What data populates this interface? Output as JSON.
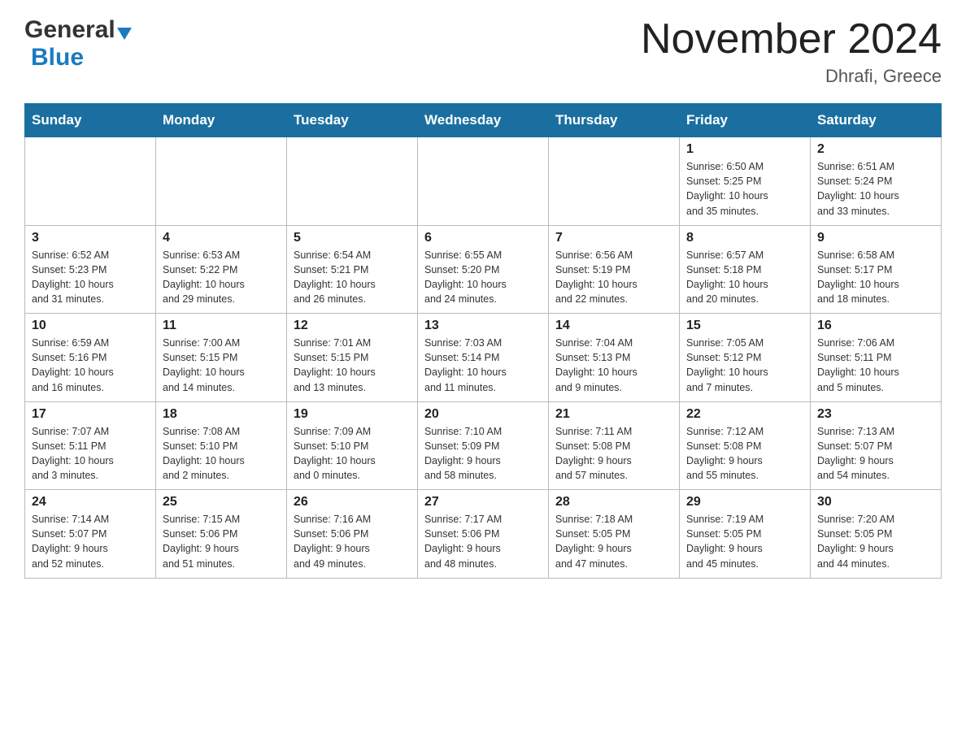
{
  "header": {
    "logo_general": "General",
    "logo_blue": "Blue",
    "month_year": "November 2024",
    "location": "Dhrafi, Greece"
  },
  "weekdays": [
    "Sunday",
    "Monday",
    "Tuesday",
    "Wednesday",
    "Thursday",
    "Friday",
    "Saturday"
  ],
  "rows": [
    [
      {
        "day": "",
        "info": ""
      },
      {
        "day": "",
        "info": ""
      },
      {
        "day": "",
        "info": ""
      },
      {
        "day": "",
        "info": ""
      },
      {
        "day": "",
        "info": ""
      },
      {
        "day": "1",
        "info": "Sunrise: 6:50 AM\nSunset: 5:25 PM\nDaylight: 10 hours\nand 35 minutes."
      },
      {
        "day": "2",
        "info": "Sunrise: 6:51 AM\nSunset: 5:24 PM\nDaylight: 10 hours\nand 33 minutes."
      }
    ],
    [
      {
        "day": "3",
        "info": "Sunrise: 6:52 AM\nSunset: 5:23 PM\nDaylight: 10 hours\nand 31 minutes."
      },
      {
        "day": "4",
        "info": "Sunrise: 6:53 AM\nSunset: 5:22 PM\nDaylight: 10 hours\nand 29 minutes."
      },
      {
        "day": "5",
        "info": "Sunrise: 6:54 AM\nSunset: 5:21 PM\nDaylight: 10 hours\nand 26 minutes."
      },
      {
        "day": "6",
        "info": "Sunrise: 6:55 AM\nSunset: 5:20 PM\nDaylight: 10 hours\nand 24 minutes."
      },
      {
        "day": "7",
        "info": "Sunrise: 6:56 AM\nSunset: 5:19 PM\nDaylight: 10 hours\nand 22 minutes."
      },
      {
        "day": "8",
        "info": "Sunrise: 6:57 AM\nSunset: 5:18 PM\nDaylight: 10 hours\nand 20 minutes."
      },
      {
        "day": "9",
        "info": "Sunrise: 6:58 AM\nSunset: 5:17 PM\nDaylight: 10 hours\nand 18 minutes."
      }
    ],
    [
      {
        "day": "10",
        "info": "Sunrise: 6:59 AM\nSunset: 5:16 PM\nDaylight: 10 hours\nand 16 minutes."
      },
      {
        "day": "11",
        "info": "Sunrise: 7:00 AM\nSunset: 5:15 PM\nDaylight: 10 hours\nand 14 minutes."
      },
      {
        "day": "12",
        "info": "Sunrise: 7:01 AM\nSunset: 5:15 PM\nDaylight: 10 hours\nand 13 minutes."
      },
      {
        "day": "13",
        "info": "Sunrise: 7:03 AM\nSunset: 5:14 PM\nDaylight: 10 hours\nand 11 minutes."
      },
      {
        "day": "14",
        "info": "Sunrise: 7:04 AM\nSunset: 5:13 PM\nDaylight: 10 hours\nand 9 minutes."
      },
      {
        "day": "15",
        "info": "Sunrise: 7:05 AM\nSunset: 5:12 PM\nDaylight: 10 hours\nand 7 minutes."
      },
      {
        "day": "16",
        "info": "Sunrise: 7:06 AM\nSunset: 5:11 PM\nDaylight: 10 hours\nand 5 minutes."
      }
    ],
    [
      {
        "day": "17",
        "info": "Sunrise: 7:07 AM\nSunset: 5:11 PM\nDaylight: 10 hours\nand 3 minutes."
      },
      {
        "day": "18",
        "info": "Sunrise: 7:08 AM\nSunset: 5:10 PM\nDaylight: 10 hours\nand 2 minutes."
      },
      {
        "day": "19",
        "info": "Sunrise: 7:09 AM\nSunset: 5:10 PM\nDaylight: 10 hours\nand 0 minutes."
      },
      {
        "day": "20",
        "info": "Sunrise: 7:10 AM\nSunset: 5:09 PM\nDaylight: 9 hours\nand 58 minutes."
      },
      {
        "day": "21",
        "info": "Sunrise: 7:11 AM\nSunset: 5:08 PM\nDaylight: 9 hours\nand 57 minutes."
      },
      {
        "day": "22",
        "info": "Sunrise: 7:12 AM\nSunset: 5:08 PM\nDaylight: 9 hours\nand 55 minutes."
      },
      {
        "day": "23",
        "info": "Sunrise: 7:13 AM\nSunset: 5:07 PM\nDaylight: 9 hours\nand 54 minutes."
      }
    ],
    [
      {
        "day": "24",
        "info": "Sunrise: 7:14 AM\nSunset: 5:07 PM\nDaylight: 9 hours\nand 52 minutes."
      },
      {
        "day": "25",
        "info": "Sunrise: 7:15 AM\nSunset: 5:06 PM\nDaylight: 9 hours\nand 51 minutes."
      },
      {
        "day": "26",
        "info": "Sunrise: 7:16 AM\nSunset: 5:06 PM\nDaylight: 9 hours\nand 49 minutes."
      },
      {
        "day": "27",
        "info": "Sunrise: 7:17 AM\nSunset: 5:06 PM\nDaylight: 9 hours\nand 48 minutes."
      },
      {
        "day": "28",
        "info": "Sunrise: 7:18 AM\nSunset: 5:05 PM\nDaylight: 9 hours\nand 47 minutes."
      },
      {
        "day": "29",
        "info": "Sunrise: 7:19 AM\nSunset: 5:05 PM\nDaylight: 9 hours\nand 45 minutes."
      },
      {
        "day": "30",
        "info": "Sunrise: 7:20 AM\nSunset: 5:05 PM\nDaylight: 9 hours\nand 44 minutes."
      }
    ]
  ]
}
